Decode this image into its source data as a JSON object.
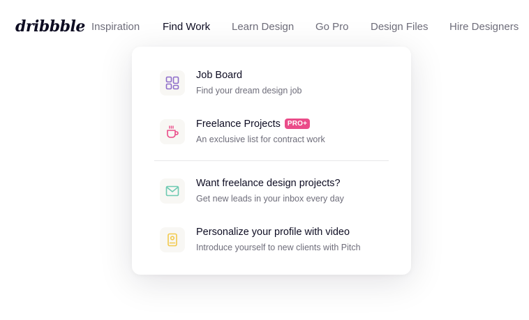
{
  "logo": "dribbble",
  "nav": {
    "items": [
      {
        "label": "Inspiration"
      },
      {
        "label": "Find Work"
      },
      {
        "label": "Learn Design"
      },
      {
        "label": "Go Pro"
      },
      {
        "label": "Design Files"
      },
      {
        "label": "Hire Designers"
      }
    ],
    "active": "Find Work"
  },
  "dropdown": {
    "items": [
      {
        "title": "Job Board",
        "description": "Find your dream design job",
        "icon": "job-board-icon",
        "icon_color": "#8d6cc9"
      },
      {
        "title": "Freelance Projects",
        "badge": "PRO+",
        "description": "An exclusive list for contract work",
        "icon": "coffee-cup-icon",
        "icon_color": "#ea4c89"
      },
      {
        "title": "Want freelance design projects?",
        "description": "Get new leads in your inbox every day",
        "icon": "envelope-icon",
        "icon_color": "#6dc9b1"
      },
      {
        "title": "Personalize your profile with video",
        "description": "Introduce yourself to new clients with Pitch",
        "icon": "video-profile-icon",
        "icon_color": "#f2c94c"
      }
    ]
  },
  "colors": {
    "text_primary": "#0d0c22",
    "text_secondary": "#6e6d7a",
    "badge": "#ea4c89"
  }
}
